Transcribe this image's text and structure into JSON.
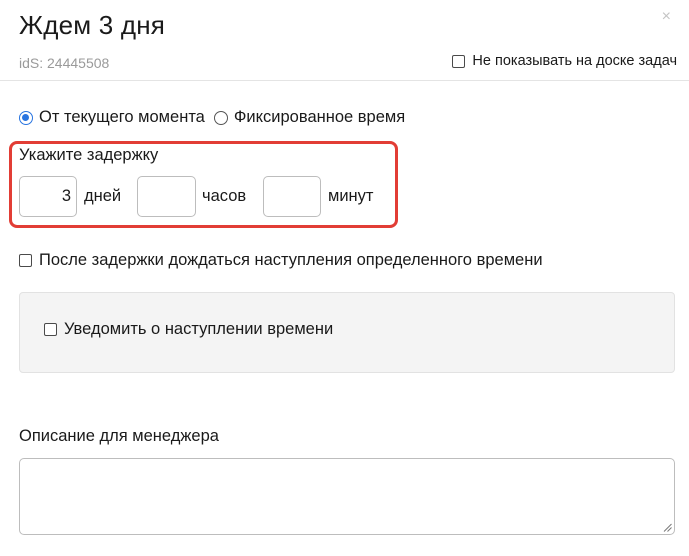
{
  "modal": {
    "title": "Ждем 3 дня",
    "close_glyph": "×",
    "ids_text": "idS: 24445508",
    "hide_board_label": "Не показывать на доске задач"
  },
  "mode": {
    "options": [
      {
        "label": "От текущего момента",
        "checked": true
      },
      {
        "label": "Фиксированное время",
        "checked": false
      }
    ]
  },
  "delay": {
    "label": "Укажите задержку",
    "days_value": "3",
    "days_unit": "дней",
    "hours_value": "",
    "hours_unit": "часов",
    "minutes_value": "",
    "minutes_unit": "минут",
    "highlight_color": "#e23d35"
  },
  "after_delay": {
    "label": "После задержки дождаться наступления определенного времени",
    "checked": false
  },
  "notify": {
    "label": "Уведомить о наступлении времени",
    "checked": false
  },
  "description": {
    "label": "Описание для менеджера",
    "value": ""
  },
  "colors": {
    "accent": "#2874e0",
    "highlight": "#e23d35"
  }
}
